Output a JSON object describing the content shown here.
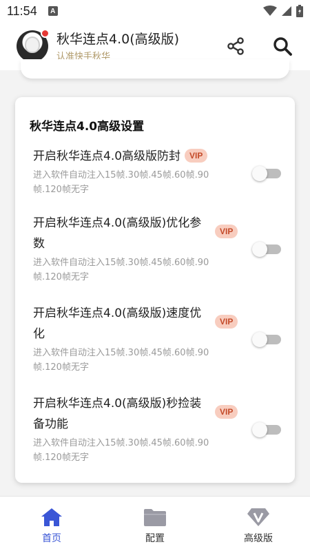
{
  "status_bar": {
    "time": "11:54",
    "notification_glyph": "A"
  },
  "header": {
    "title": "秋华连点4.0(高级版)",
    "subtitle": "认准快手秋华",
    "share_icon": "share-icon",
    "search_icon": "search-icon"
  },
  "settings_card": {
    "title": "秋华连点4.0高级设置",
    "items": [
      {
        "label": "开启秋华连点4.0高级版防封",
        "badge": "VIP",
        "description": "进入软件自动注入15帧.30帧.45帧.60帧.90帧.120帧无字",
        "enabled": false
      },
      {
        "label": "开启秋华连点4.0(高级版)优化参数",
        "badge": "VIP",
        "description": "进入软件自动注入15帧.30帧.45帧.60帧.90帧.120帧无字",
        "enabled": false
      },
      {
        "label": "开启秋华连点4.0(高级版)速度优化",
        "badge": "VIP",
        "description": "进入软件自动注入15帧.30帧.45帧.60帧.90帧.120帧无字",
        "enabled": false
      },
      {
        "label": "开启秋华连点4.0(高级版)秒捡装备功能",
        "badge": "VIP",
        "description": "进入软件自动注入15帧.30帧.45帧.60帧.90帧.120帧无字",
        "enabled": false
      }
    ]
  },
  "bottom_nav": {
    "items": [
      {
        "label": "首页",
        "icon": "home-icon",
        "active": true
      },
      {
        "label": "配置",
        "icon": "folder-icon",
        "active": false
      },
      {
        "label": "高级版",
        "icon": "diamond-v-icon",
        "active": false
      }
    ]
  },
  "colors": {
    "accent": "#3a56d6",
    "vip_bg": "#f8cdbf",
    "vip_text": "#c44b2a",
    "subtitle": "#b09a6a"
  }
}
